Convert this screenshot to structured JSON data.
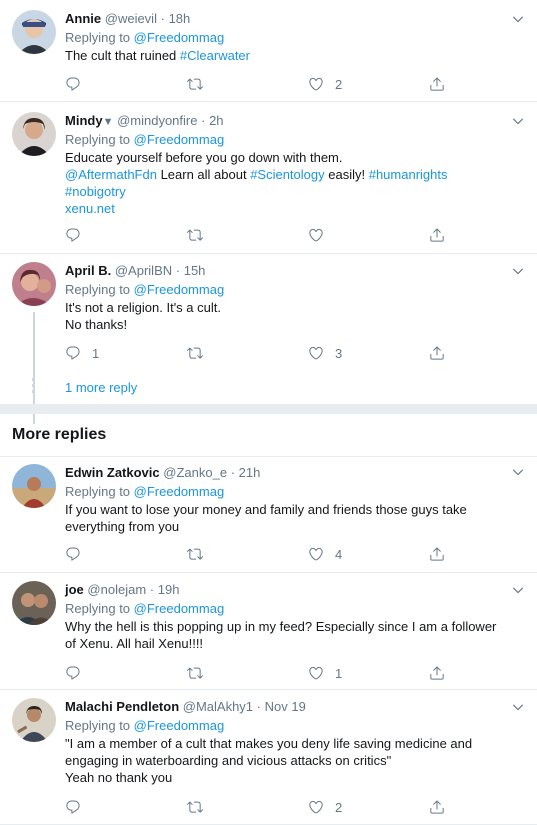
{
  "colors": {
    "link": "#1b95e0",
    "muted": "#657786",
    "text": "#14171a",
    "divider": "#e6ecf0"
  },
  "thread_replies": [
    {
      "name": "Annie",
      "handle": "@weievil",
      "time": "18h",
      "replying_label": "Replying to",
      "replying_to": "@Freedommag",
      "text_plain": "The cult that ruined ",
      "hashtag": "#Clearwater",
      "reply_count": "",
      "retweet_count": "",
      "like_count": "2"
    },
    {
      "name": "Mindy",
      "handle": "@mindyonfire",
      "time": "2h",
      "replying_label": "Replying to",
      "replying_to": "@Freedommag",
      "line1": "Educate yourself before you go down with them.",
      "line2_mention": "@AftermathFdn",
      "line2_text": " Learn all about ",
      "line2_tag1": "#Scientology",
      "line2_text2": " easily! ",
      "line2_tag2": "#humanrights",
      "line3_tag": " #nobigotry",
      "line4_link": "xenu.net",
      "reply_count": "",
      "retweet_count": "",
      "like_count": ""
    },
    {
      "name": "April B.",
      "handle": "@AprilBN",
      "time": "15h",
      "replying_label": "Replying to",
      "replying_to": "@Freedommag",
      "line1": "It's not a religion. It's a cult.",
      "line2": "No thanks!",
      "reply_count": "1",
      "retweet_count": "",
      "like_count": "3"
    }
  ],
  "more_reply_link": "1 more reply",
  "section_title": "More replies",
  "more_replies": [
    {
      "name": "Edwin Zatkovic",
      "handle": "@Zanko_e",
      "time": "21h",
      "replying_label": "Replying to",
      "replying_to": "@Freedommag",
      "line1": "If you want to lose your money and family and friends those guys take",
      "line2": "everything from you",
      "reply_count": "",
      "retweet_count": "",
      "like_count": "4"
    },
    {
      "name": "joe",
      "handle": "@nolejam",
      "time": "19h",
      "replying_label": "Replying to",
      "replying_to": "@Freedommag",
      "line1": "Why the hell is this popping up in my feed? Especially since I am a follower",
      "line2": "of Xenu. All hail Xenu!!!!",
      "reply_count": "",
      "retweet_count": "",
      "like_count": "1"
    },
    {
      "name": "Malachi Pendleton",
      "handle": "@MalAkhy1",
      "time": "Nov 19",
      "replying_label": "Replying to",
      "replying_to": "@Freedommag",
      "line1": "\"I am a member of a cult that makes you deny life saving medicine and",
      "line2": "engaging in waterboarding and vicious attacks on critics\"",
      "line3": "Yeah no thank you",
      "reply_count": "",
      "retweet_count": "",
      "like_count": "2"
    }
  ],
  "dot": "·"
}
